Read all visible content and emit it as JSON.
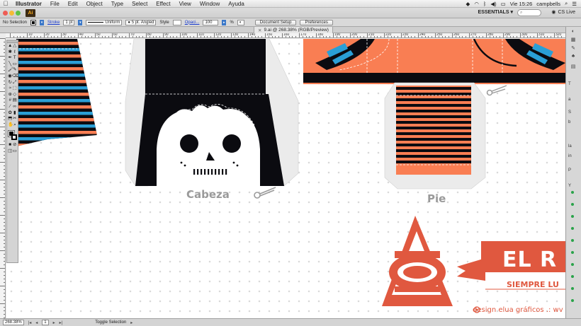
{
  "menubar": {
    "apple": "",
    "app_name": "Illustrator",
    "items": [
      "File",
      "Edit",
      "Object",
      "Type",
      "Select",
      "Effect",
      "View",
      "Window",
      "Ayuda"
    ],
    "clock": "Vie 15:26",
    "user": "campbells"
  },
  "appbar": {
    "app_icon": "Ai",
    "workspace": "ESSENTIALS",
    "cs_live": "CS Live"
  },
  "controlbar": {
    "selection": "No Selection",
    "stroke_label": "Stroke",
    "stroke_weight": "1 pt",
    "profile": "Uniform",
    "brush": "5 pt. Angled",
    "style_label": "Style",
    "opacity_label": "Opaci...",
    "opacity_value": "100",
    "opacity_unit": "%",
    "document_setup": "Document Setup",
    "preferences": "Preferences"
  },
  "tab": {
    "title": "9.ai @ 268.38% (RGB/Preview)"
  },
  "ruler": {
    "labels": [
      "10",
      "20",
      "30",
      "40",
      "50",
      "60",
      "70",
      "80",
      "90",
      "100",
      "110",
      "120",
      "130",
      "140",
      "150",
      "160",
      "170",
      "180",
      "190",
      "200",
      "210",
      "220",
      "230",
      "240",
      "250",
      "260",
      "270",
      "280",
      "290",
      "300",
      "310",
      "320",
      "330"
    ]
  },
  "tools": {
    "icons": [
      [
        "selection-tool",
        "▲",
        "direct-selection-tool",
        "△"
      ],
      [
        "magic-wand-tool",
        "✱",
        "lasso-tool",
        "ℓ"
      ],
      [
        "pen-tool",
        "✒",
        "type-tool",
        "T"
      ],
      [
        "line-tool",
        "╲",
        "rectangle-tool",
        "▭"
      ],
      [
        "paintbrush-tool",
        "🖌",
        "pencil-tool",
        "✎"
      ],
      [
        "blob-brush-tool",
        "◉",
        "eraser-tool",
        "⌫"
      ],
      [
        "rotate-tool",
        "↻",
        "scale-tool",
        "⤢"
      ],
      [
        "width-tool",
        "≈",
        "free-transform-tool",
        "⬚"
      ],
      [
        "shape-builder-tool",
        "⊕",
        "perspective-tool",
        "◇"
      ],
      [
        "mesh-tool",
        "#",
        "gradient-tool",
        "▤"
      ],
      [
        "eyedropper-tool",
        "⁄",
        "blend-tool",
        "∞"
      ],
      [
        "symbol-sprayer-tool",
        "✿",
        "column-graph-tool",
        "▮"
      ],
      [
        "artboard-tool",
        "⬒",
        "slice-tool",
        "✂"
      ],
      [
        "hand-tool",
        "✋",
        "zoom-tool",
        "⌕"
      ]
    ]
  },
  "artboard": {
    "head_label": "Cabeza",
    "foot_label": "Pie",
    "logo_text": "EL R",
    "logo_tagline": "SIEMPRE LU",
    "credit": "design elua gráficos .: wv"
  },
  "statusbar": {
    "zoom": "268.38%",
    "page": "1",
    "status": "Toggle Selection"
  },
  "colors": {
    "orange": "#f97e53",
    "blue": "#2a9fd6",
    "black": "#0b0b10",
    "logo_red": "#e0583f",
    "paper_gray": "#ebebeb"
  },
  "rightpanel": {
    "texts": [
      "T",
      "a",
      "S",
      "b",
      "la",
      "in",
      "P",
      "Y"
    ]
  }
}
